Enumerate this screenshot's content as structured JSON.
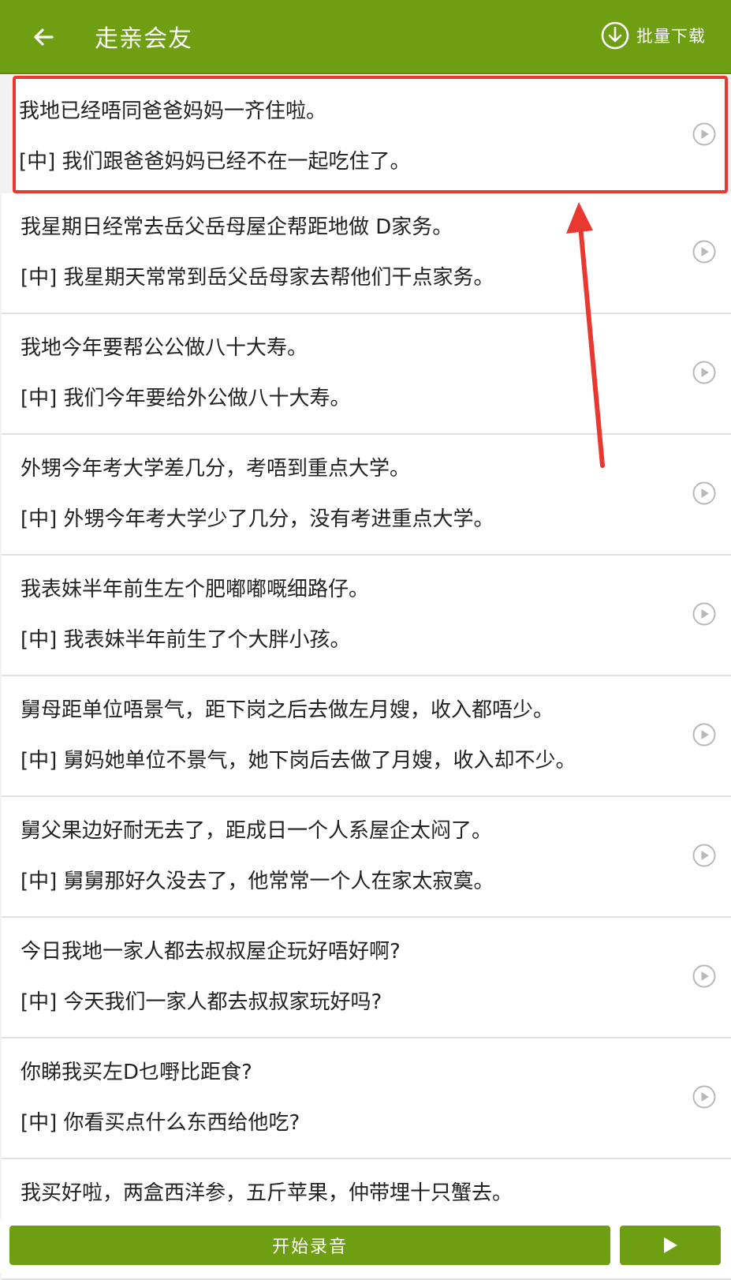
{
  "header": {
    "title": "走亲会友",
    "batch_download_label": "批量下载",
    "back_icon": "arrow-left-icon",
    "download_icon": "download-circle-icon"
  },
  "items": [
    {
      "cantonese": "我地已经唔同爸爸妈妈一齐住啦。",
      "mandarin": "[中] 我们跟爸爸妈妈已经不在一起吃住了。"
    },
    {
      "cantonese": "我星期日经常去岳父岳母屋企帮距地做 D家务。",
      "mandarin": "[中] 我星期天常常到岳父岳母家去帮他们干点家务。"
    },
    {
      "cantonese": "我地今年要帮公公做八十大寿。",
      "mandarin": "[中] 我们今年要给外公做八十大寿。"
    },
    {
      "cantonese": "外甥今年考大学差几分，考唔到重点大学。",
      "mandarin": "[中] 外甥今年考大学少了几分，没有考进重点大学。"
    },
    {
      "cantonese": "我表妹半年前生左个肥嘟嘟嘅细路仔。",
      "mandarin": "[中] 我表妹半年前生了个大胖小孩。"
    },
    {
      "cantonese": "舅母距单位唔景气，距下岗之后去做左月嫂，收入都唔少。",
      "mandarin": "[中] 舅妈她单位不景气，她下岗后去做了月嫂，收入却不少。"
    },
    {
      "cantonese": "舅父果边好耐无去了，距成日一个人系屋企太闷了。",
      "mandarin": "[中] 舅舅那好久没去了，他常常一个人在家太寂寞。"
    },
    {
      "cantonese": "今日我地一家人都去叔叔屋企玩好唔好啊?",
      "mandarin": "[中] 今天我们一家人都去叔叔家玩好吗?"
    },
    {
      "cantonese": "你睇我买左D乜嘢比距食?",
      "mandarin": "[中] 你看买点什么东西给他吃?"
    },
    {
      "cantonese": "我买好啦，两盒西洋参，五斤苹果，仲带埋十只蟹去。",
      "mandarin": ""
    }
  ],
  "bottom": {
    "record_label": "开始录音",
    "play_icon": "play-triangle-icon"
  },
  "colors": {
    "brand_green": "#6e9e12",
    "highlight_red": "#e8382f"
  }
}
